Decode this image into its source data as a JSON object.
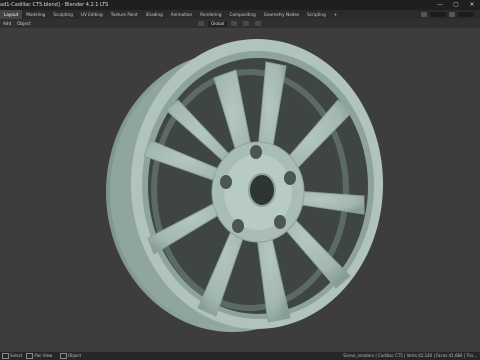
{
  "window": {
    "title": "ad1-Cadillac CT5.blend] - Blender 4.2.1 LTS",
    "controls": [
      "—",
      "▢",
      "✕"
    ]
  },
  "workspaces": [
    {
      "label": "Layout",
      "active": true
    },
    {
      "label": "Modeling",
      "active": false
    },
    {
      "label": "Sculpting",
      "active": false
    },
    {
      "label": "UV Editing",
      "active": false
    },
    {
      "label": "Texture Paint",
      "active": false
    },
    {
      "label": "Shading",
      "active": false
    },
    {
      "label": "Animation",
      "active": false
    },
    {
      "label": "Rendering",
      "active": false
    },
    {
      "label": "Compositing",
      "active": false
    },
    {
      "label": "Geometry Nodes",
      "active": false
    },
    {
      "label": "Scripting",
      "active": false
    },
    {
      "label": "+",
      "active": false
    }
  ],
  "header": {
    "menus": [
      "Add",
      "Object"
    ],
    "orientation": "Global"
  },
  "statusbar": {
    "left": [
      "Select",
      "Pan View",
      "Object"
    ],
    "right": "Scene_nmaters | Cadillac CT5 | Verts:42,140 | Faces:41,684 | Tris..."
  },
  "colors": {
    "background": "#3d3d3d",
    "wheel": "#9fb4ac"
  }
}
